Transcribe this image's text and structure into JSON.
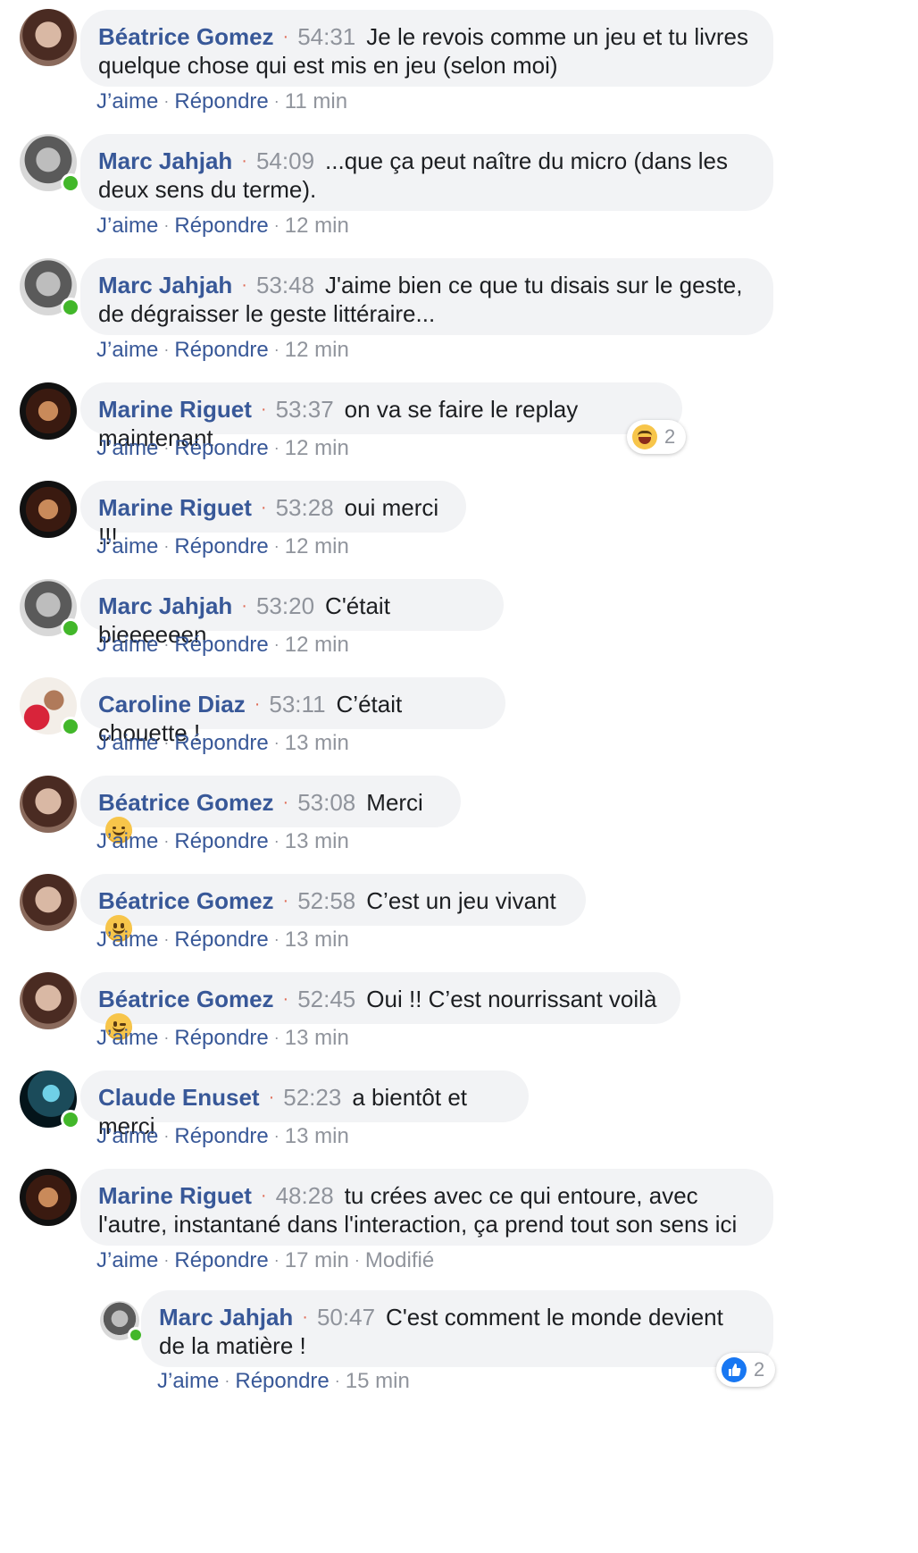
{
  "actions": {
    "like": "J’aime",
    "reply": "Répondre"
  },
  "comments": [
    {
      "author": "Béatrice Gomez",
      "timestamp": "54:31",
      "text": "Je le revois comme un jeu et tu livres quelque chose qui est mis en jeu (selon moi)",
      "age": "11 min",
      "online": false,
      "avatar": "avatar-beatrice"
    },
    {
      "author": "Marc Jahjah",
      "timestamp": "54:09",
      "text": "...que ça peut naître du micro (dans les deux sens du terme).",
      "age": "12 min",
      "online": true,
      "avatar": "avatar-marc"
    },
    {
      "author": "Marc Jahjah",
      "timestamp": "53:48",
      "text": "J'aime bien ce que tu disais sur le geste, de dégraisser le geste littéraire...",
      "age": "12 min",
      "online": true,
      "avatar": "avatar-marc"
    },
    {
      "author": "Marine Riguet",
      "timestamp": "53:37",
      "text": "on va se faire le replay maintenant",
      "age": "12 min",
      "online": false,
      "avatar": "avatar-marine",
      "reaction": {
        "icon": "laughing-emoji-icon",
        "count": "2"
      }
    },
    {
      "author": "Marine Riguet",
      "timestamp": "53:28",
      "text": "oui merci !!!",
      "age": "12 min",
      "online": false,
      "avatar": "avatar-marine"
    },
    {
      "author": "Marc Jahjah",
      "timestamp": "53:20",
      "text": "C'était bieeeeeen",
      "age": "12 min",
      "online": true,
      "avatar": "avatar-marc"
    },
    {
      "author": "Caroline Diaz",
      "timestamp": "53:11",
      "text": "C’était chouette !",
      "age": "13 min",
      "online": true,
      "avatar": "avatar-caroline"
    },
    {
      "author": "Béatrice Gomez",
      "timestamp": "53:08",
      "text": "Merci",
      "age": "13 min",
      "online": false,
      "avatar": "avatar-beatrice",
      "emoji": "smiling-eyes-emoji-icon"
    },
    {
      "author": "Béatrice Gomez",
      "timestamp": "52:58",
      "text": "C’est un jeu vivant",
      "age": "13 min",
      "online": false,
      "avatar": "avatar-beatrice",
      "emoji": "slight-smile-emoji-icon"
    },
    {
      "author": "Béatrice Gomez",
      "timestamp": "52:45",
      "text": "Oui !! C’est nourrissant voilà",
      "age": "13 min",
      "online": false,
      "avatar": "avatar-beatrice",
      "emoji": "wink-emoji-icon"
    },
    {
      "author": "Claude Enuset",
      "timestamp": "52:23",
      "text": "a bientôt et merci",
      "age": "13 min",
      "online": true,
      "avatar": "avatar-claude"
    },
    {
      "author": "Marine Riguet",
      "timestamp": "48:28",
      "text": "tu crées avec ce qui entoure, avec l'autre, instantané dans l'interaction, ça prend tout son sens ici",
      "age": "17 min",
      "edited": "Modifié",
      "online": false,
      "avatar": "avatar-marine"
    }
  ],
  "reply": {
    "author": "Marc Jahjah",
    "timestamp": "50:47",
    "text": "C'est comment le monde devient de la matière !",
    "age": "15 min",
    "online": true,
    "avatar": "avatar-marc",
    "reaction": {
      "icon": "thumbs-up-icon",
      "count": "2"
    }
  },
  "colors": {
    "name": "#385898",
    "bubble": "#f2f3f5",
    "meta": "#90949c",
    "online": "#42b72a",
    "like": "#1877f2"
  }
}
